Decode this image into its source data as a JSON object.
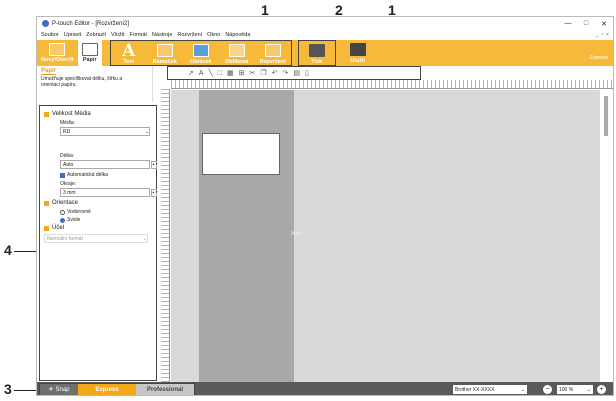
{
  "callouts": {
    "c1a": "1",
    "c2": "2",
    "c1b": "1",
    "c3": "3",
    "c4": "4"
  },
  "window": {
    "title": "P-touch Editor - [Rozvržení2]",
    "min": "—",
    "max": "□",
    "close": "✕"
  },
  "menu": [
    "Soubor",
    "Upravit",
    "Zobrazit",
    "Vložit",
    "Formát",
    "Nástroje",
    "Rozvržení",
    "Okno",
    "Nápověda"
  ],
  "menu_right": "_ ♂ ×",
  "ribbon": {
    "new_open": "Nový/Otevřít",
    "paper": "Papír",
    "text": "Text",
    "frame": "Rámeček",
    "image": "Obrázek",
    "favorite": "Oblíbená",
    "layout": "Rozvržení",
    "print": "Tisk",
    "save": "Uložit",
    "mode": "Express"
  },
  "panel_head": {
    "title": "Papír",
    "desc": "Umožňuje specifikovat délku, šířku a orientaci papíru."
  },
  "props": {
    "media_section": "Velikost Média",
    "media_label": "Média:",
    "media_value": "RD",
    "length_label": "Délka:",
    "length_value": "Auto",
    "auto_length": "Automatická délka",
    "margin_label": "Okraje:",
    "margin_value": "3 mm",
    "orient_section": "Orientace",
    "horizontal": "Vodorovně",
    "vertical": "Svisle",
    "purpose_section": "Účel",
    "purpose_value": "Normální formát"
  },
  "canvas": {
    "auto": "Auto"
  },
  "status": {
    "snap": "Snap",
    "express": "Express",
    "professional": "Professional",
    "printer": "Brother XX-XXXX",
    "zoom": "100 %"
  },
  "colors": {
    "ribbon": "#f6b93a",
    "express_tab": "#f2a819",
    "status_bar": "#5a5a5a"
  }
}
